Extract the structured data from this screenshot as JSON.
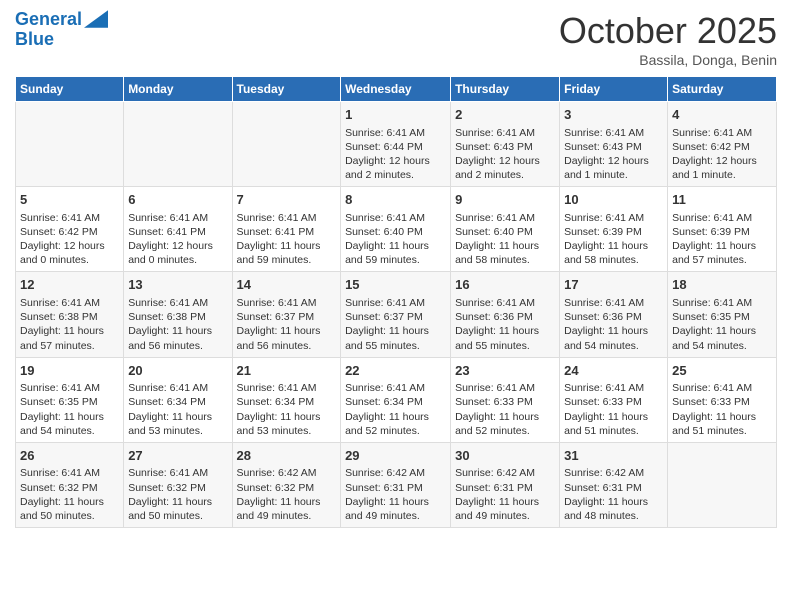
{
  "logo": {
    "line1": "General",
    "line2": "Blue"
  },
  "title": "October 2025",
  "location": "Bassila, Donga, Benin",
  "days_of_week": [
    "Sunday",
    "Monday",
    "Tuesday",
    "Wednesday",
    "Thursday",
    "Friday",
    "Saturday"
  ],
  "weeks": [
    {
      "days": [
        {
          "num": "",
          "info": ""
        },
        {
          "num": "",
          "info": ""
        },
        {
          "num": "",
          "info": ""
        },
        {
          "num": "1",
          "info": "Sunrise: 6:41 AM\nSunset: 6:44 PM\nDaylight: 12 hours and 2 minutes."
        },
        {
          "num": "2",
          "info": "Sunrise: 6:41 AM\nSunset: 6:43 PM\nDaylight: 12 hours and 2 minutes."
        },
        {
          "num": "3",
          "info": "Sunrise: 6:41 AM\nSunset: 6:43 PM\nDaylight: 12 hours and 1 minute."
        },
        {
          "num": "4",
          "info": "Sunrise: 6:41 AM\nSunset: 6:42 PM\nDaylight: 12 hours and 1 minute."
        }
      ]
    },
    {
      "days": [
        {
          "num": "5",
          "info": "Sunrise: 6:41 AM\nSunset: 6:42 PM\nDaylight: 12 hours and 0 minutes."
        },
        {
          "num": "6",
          "info": "Sunrise: 6:41 AM\nSunset: 6:41 PM\nDaylight: 12 hours and 0 minutes."
        },
        {
          "num": "7",
          "info": "Sunrise: 6:41 AM\nSunset: 6:41 PM\nDaylight: 11 hours and 59 minutes."
        },
        {
          "num": "8",
          "info": "Sunrise: 6:41 AM\nSunset: 6:40 PM\nDaylight: 11 hours and 59 minutes."
        },
        {
          "num": "9",
          "info": "Sunrise: 6:41 AM\nSunset: 6:40 PM\nDaylight: 11 hours and 58 minutes."
        },
        {
          "num": "10",
          "info": "Sunrise: 6:41 AM\nSunset: 6:39 PM\nDaylight: 11 hours and 58 minutes."
        },
        {
          "num": "11",
          "info": "Sunrise: 6:41 AM\nSunset: 6:39 PM\nDaylight: 11 hours and 57 minutes."
        }
      ]
    },
    {
      "days": [
        {
          "num": "12",
          "info": "Sunrise: 6:41 AM\nSunset: 6:38 PM\nDaylight: 11 hours and 57 minutes."
        },
        {
          "num": "13",
          "info": "Sunrise: 6:41 AM\nSunset: 6:38 PM\nDaylight: 11 hours and 56 minutes."
        },
        {
          "num": "14",
          "info": "Sunrise: 6:41 AM\nSunset: 6:37 PM\nDaylight: 11 hours and 56 minutes."
        },
        {
          "num": "15",
          "info": "Sunrise: 6:41 AM\nSunset: 6:37 PM\nDaylight: 11 hours and 55 minutes."
        },
        {
          "num": "16",
          "info": "Sunrise: 6:41 AM\nSunset: 6:36 PM\nDaylight: 11 hours and 55 minutes."
        },
        {
          "num": "17",
          "info": "Sunrise: 6:41 AM\nSunset: 6:36 PM\nDaylight: 11 hours and 54 minutes."
        },
        {
          "num": "18",
          "info": "Sunrise: 6:41 AM\nSunset: 6:35 PM\nDaylight: 11 hours and 54 minutes."
        }
      ]
    },
    {
      "days": [
        {
          "num": "19",
          "info": "Sunrise: 6:41 AM\nSunset: 6:35 PM\nDaylight: 11 hours and 54 minutes."
        },
        {
          "num": "20",
          "info": "Sunrise: 6:41 AM\nSunset: 6:34 PM\nDaylight: 11 hours and 53 minutes."
        },
        {
          "num": "21",
          "info": "Sunrise: 6:41 AM\nSunset: 6:34 PM\nDaylight: 11 hours and 53 minutes."
        },
        {
          "num": "22",
          "info": "Sunrise: 6:41 AM\nSunset: 6:34 PM\nDaylight: 11 hours and 52 minutes."
        },
        {
          "num": "23",
          "info": "Sunrise: 6:41 AM\nSunset: 6:33 PM\nDaylight: 11 hours and 52 minutes."
        },
        {
          "num": "24",
          "info": "Sunrise: 6:41 AM\nSunset: 6:33 PM\nDaylight: 11 hours and 51 minutes."
        },
        {
          "num": "25",
          "info": "Sunrise: 6:41 AM\nSunset: 6:33 PM\nDaylight: 11 hours and 51 minutes."
        }
      ]
    },
    {
      "days": [
        {
          "num": "26",
          "info": "Sunrise: 6:41 AM\nSunset: 6:32 PM\nDaylight: 11 hours and 50 minutes."
        },
        {
          "num": "27",
          "info": "Sunrise: 6:41 AM\nSunset: 6:32 PM\nDaylight: 11 hours and 50 minutes."
        },
        {
          "num": "28",
          "info": "Sunrise: 6:42 AM\nSunset: 6:32 PM\nDaylight: 11 hours and 49 minutes."
        },
        {
          "num": "29",
          "info": "Sunrise: 6:42 AM\nSunset: 6:31 PM\nDaylight: 11 hours and 49 minutes."
        },
        {
          "num": "30",
          "info": "Sunrise: 6:42 AM\nSunset: 6:31 PM\nDaylight: 11 hours and 49 minutes."
        },
        {
          "num": "31",
          "info": "Sunrise: 6:42 AM\nSunset: 6:31 PM\nDaylight: 11 hours and 48 minutes."
        },
        {
          "num": "",
          "info": ""
        }
      ]
    }
  ]
}
